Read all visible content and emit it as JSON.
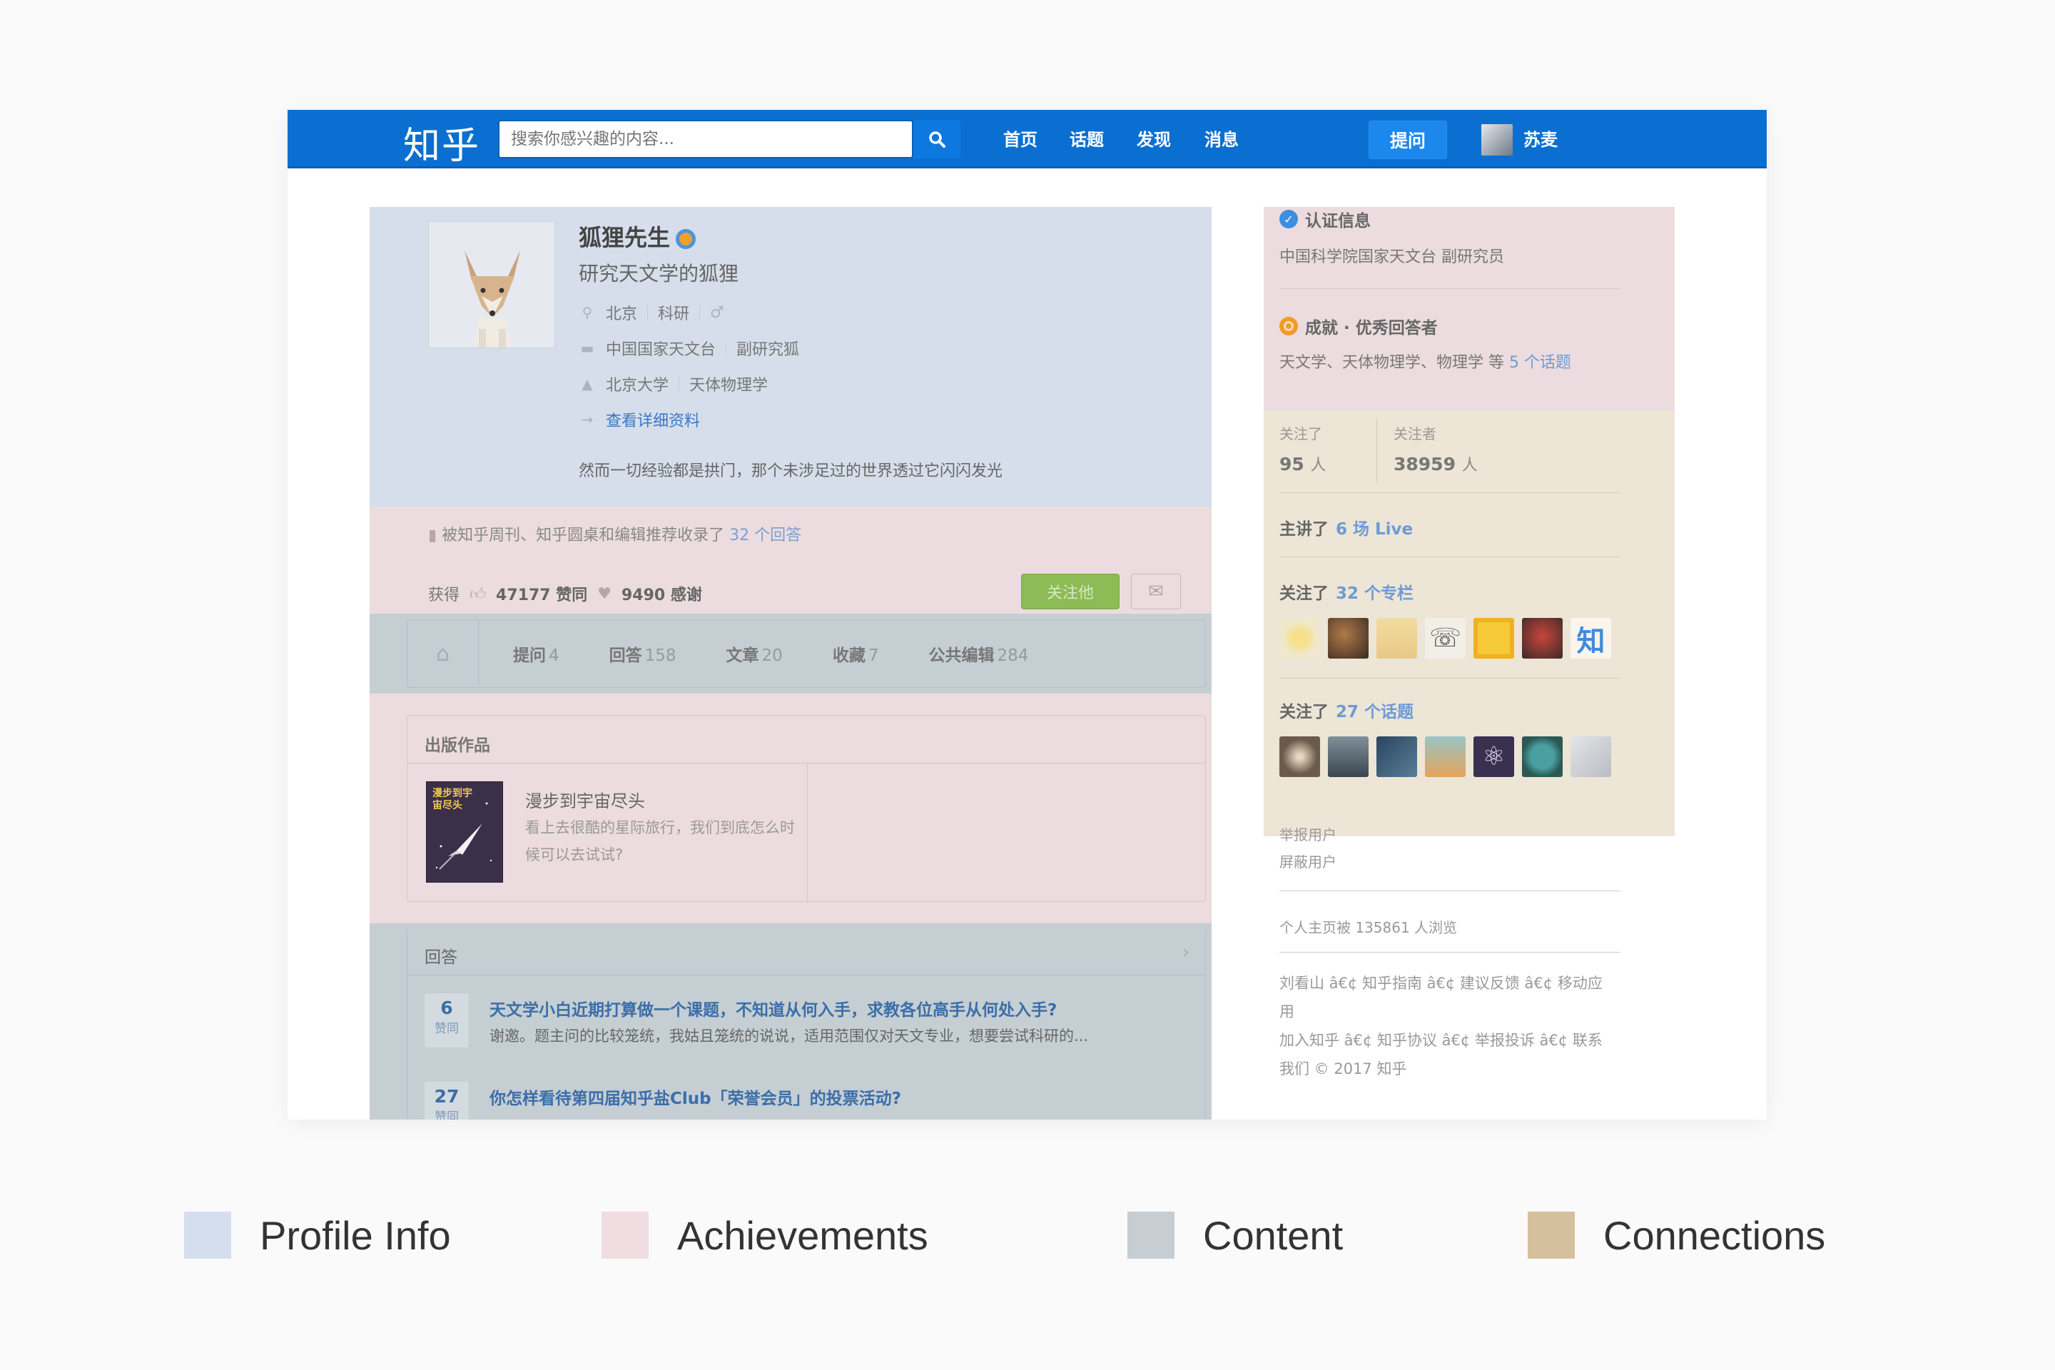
{
  "header": {
    "logo": "知乎",
    "search_placeholder": "搜索你感兴趣的内容...",
    "nav": [
      "首页",
      "话题",
      "发现",
      "消息"
    ],
    "ask_button": "提问",
    "user_name": "苏麦"
  },
  "profile": {
    "name": "狐狸先生",
    "headline": "研究天文学的狐狸",
    "location": "北京",
    "industry": "科研",
    "gender": "♂",
    "company": "中国国家天文台",
    "position": "副研究狐",
    "school": "北京大学",
    "major": "天体物理学",
    "detail_link": "查看详细资料",
    "bio": "然而一切经验都是拱门，那个未涉足过的世界透过它闪闪发光"
  },
  "achievements": {
    "recommend_text": "被知乎周刊、知乎圆桌和编辑推荐收录了",
    "recommend_link": "32 个回答",
    "obtained_label": "获得",
    "likes": "47177 赞同",
    "thanks": "9490 感谢",
    "follow_button": "关注他"
  },
  "tabs": [
    {
      "label": "提问",
      "count": "4"
    },
    {
      "label": "回答",
      "count": "158"
    },
    {
      "label": "文章",
      "count": "20"
    },
    {
      "label": "收藏",
      "count": "7"
    },
    {
      "label": "公共编辑",
      "count": "284"
    }
  ],
  "publications": {
    "title": "出版作品",
    "book_cover_text": "漫步到宇宙尽头",
    "book_title": "漫步到宇宙尽头",
    "book_desc": "看上去很酷的星际旅行，我们到底怎么时候可以去试试?"
  },
  "answers": {
    "title": "回答",
    "items": [
      {
        "votes": "6",
        "vote_label": "赞同",
        "question": "天文学小白近期打算做一个课题，不知道从何入手，求教各位高手从何处入手?",
        "excerpt": "谢邀。题主问的比较笼统，我姑且笼统的说说，适用范围仅对天文专业，想要尝试科研的..."
      },
      {
        "votes": "27",
        "vote_label": "赞同",
        "question": "你怎样看待第四届知乎盐Club「荣誉会员」的投票活动?",
        "excerpt": ""
      }
    ]
  },
  "sidebar": {
    "cert_title": "认证信息",
    "cert_text": "中国科学院国家天文台 副研究员",
    "ach_title": "成就 · 优秀回答者",
    "ach_text_prefix": "天文学、天体物理学、物理学 等",
    "ach_text_link": "5 个话题",
    "following_label": "关注了",
    "following_count": "95",
    "followers_label": "关注者",
    "followers_count": "38959",
    "people_unit": "人",
    "live_prefix": "主讲了",
    "live_link": "6 场 Live",
    "columns_prefix": "关注了",
    "columns_link": "32 个专栏",
    "topics_prefix": "关注了",
    "topics_link": "27 个话题",
    "report_user": "举报用户",
    "block_user": "屏蔽用户",
    "views_text": "个人主页被 135861 人浏览",
    "footer_line1": "刘看山 â€¢ 知乎指南 â€¢ 建议反馈 â€¢ 移动应用",
    "footer_line2": "加入知乎 â€¢ 知乎协议 â€¢ 举报投诉 â€¢ 联系我们 © 2017 知乎",
    "column_zhi": "知"
  },
  "legend": [
    {
      "label": "Profile Info",
      "color": "#d5deed"
    },
    {
      "label": "Achievements",
      "color": "#efdde1"
    },
    {
      "label": "Content",
      "color": "#c6ced3"
    },
    {
      "label": "Connections",
      "color": "#d4c09c"
    }
  ]
}
